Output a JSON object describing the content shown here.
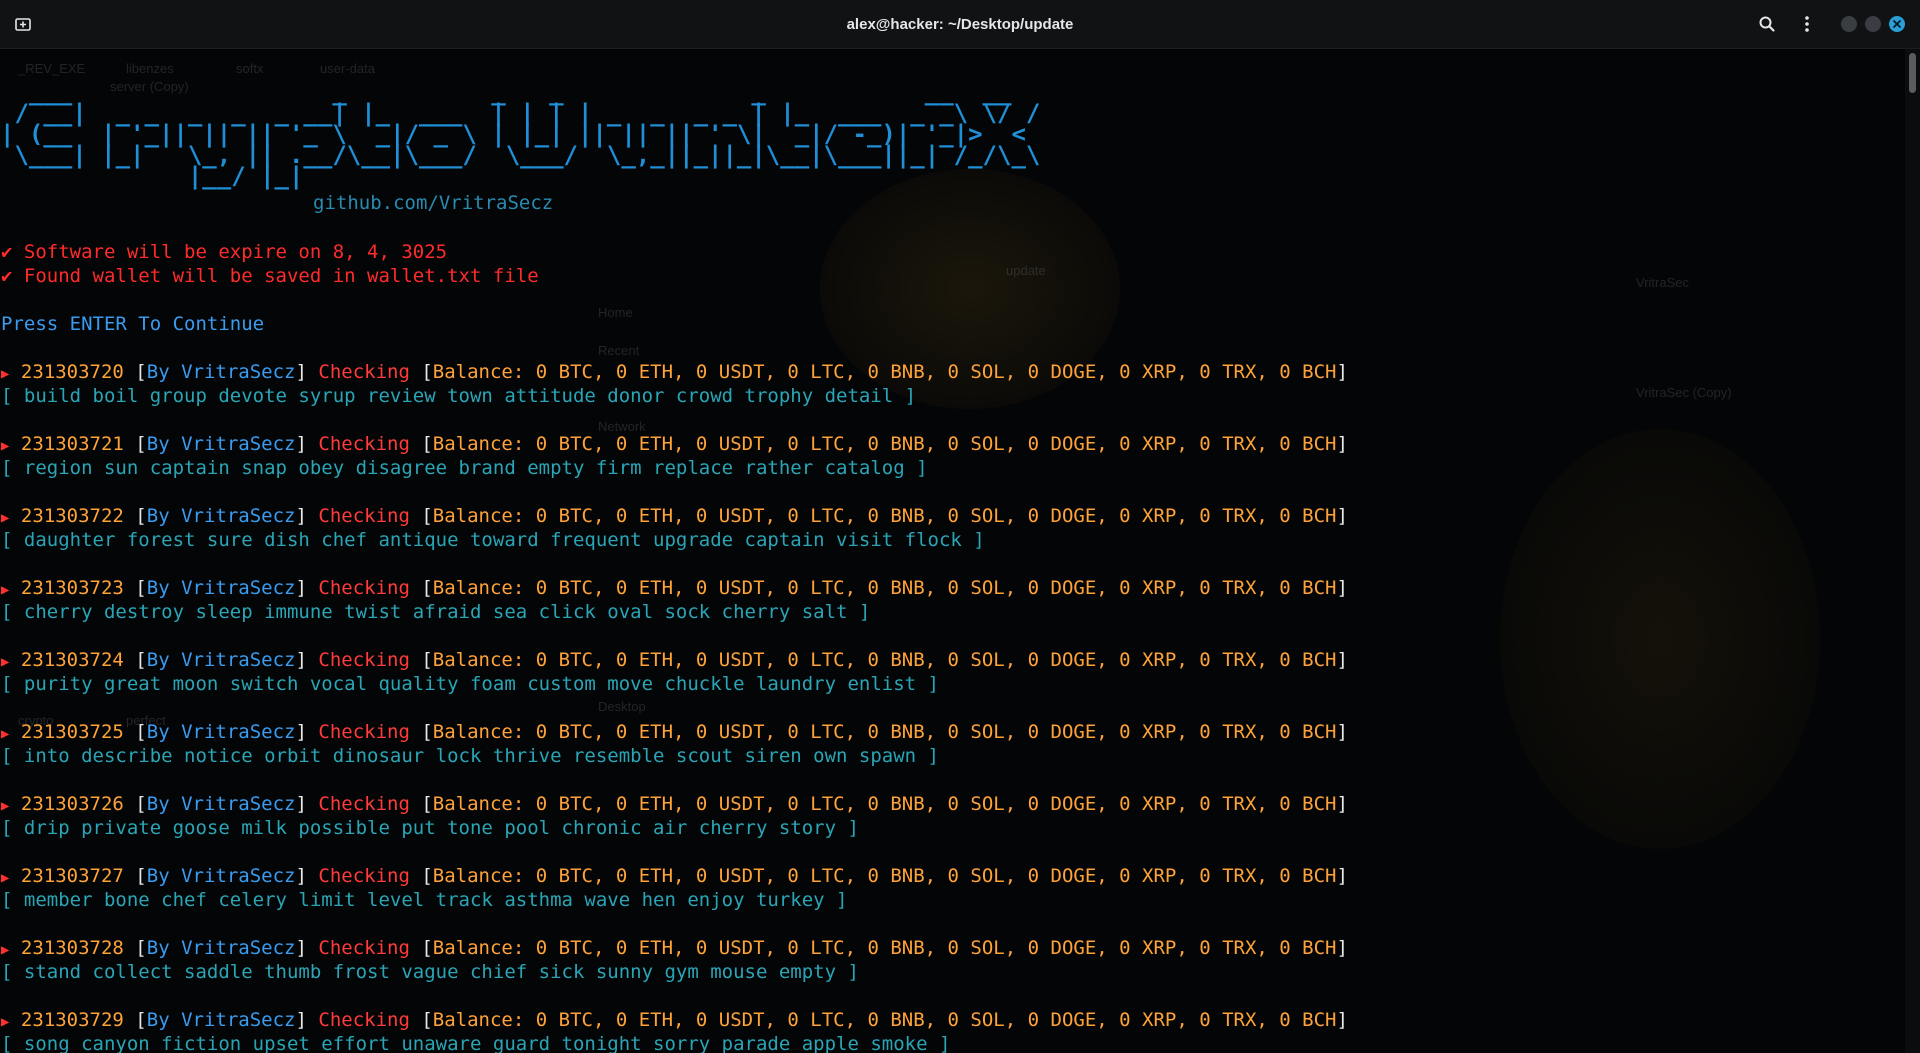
{
  "window": {
    "title": "alex@hacker: ~/Desktop/update"
  },
  "toolbar": {
    "new_tab_icon": "new-tab-icon",
    "search_icon": "search-icon",
    "menu_icon": "kebab-menu-icon",
    "minimize_icon": "minimize-icon",
    "maximize_icon": "maximize-icon",
    "close_icon": "close-icon"
  },
  "terminal": {
    "banner_lines": [
      "  ___                  _          _   _             _           __  __",
      " / __|  _ _  _  _  _ __| |_  ___  | | | | _  _  _ _ | |_  ___  _ _\\ \\/ /",
      "| (__  | '_|| || || '_ \\  _|/ _ \\ | |_| || || || ' \\|  _|/ -_)| '_|>  < ",
      " \\___| |_|   \\_, || .__/\\__|\\___/  \\___/  \\_,_||_||_|\\__|\\___||_| /_/\\_\\",
      "             |__/ |_|"
    ],
    "github": "github.com/VritraSecz",
    "notice1": "✔ Software will be expire on 8, 4, 3025",
    "notice2": "✔ Found wallet will be saved in wallet.txt file",
    "prompt": "Press ENTER To Continue",
    "by_label": "By VritraSecz",
    "checking": "Checking",
    "balance": "Balance: 0 BTC, 0 ETH, 0 USDT, 0 LTC, 0 BNB, 0 SOL, 0 DOGE, 0 XRP, 0 TRX, 0 BCH",
    "entries": [
      {
        "id": "231303720",
        "phrase": "[ build boil group devote syrup review town attitude donor crowd trophy detail ]"
      },
      {
        "id": "231303721",
        "phrase": "[ region sun captain snap obey disagree brand empty firm replace rather catalog ]"
      },
      {
        "id": "231303722",
        "phrase": "[ daughter forest sure dish chef antique toward frequent upgrade captain visit flock ]"
      },
      {
        "id": "231303723",
        "phrase": "[ cherry destroy sleep immune twist afraid sea click oval sock cherry salt ]"
      },
      {
        "id": "231303724",
        "phrase": "[ purity great moon switch vocal quality foam custom move chuckle laundry enlist ]"
      },
      {
        "id": "231303725",
        "phrase": "[ into describe notice orbit dinosaur lock thrive resemble scout siren own spawn ]"
      },
      {
        "id": "231303726",
        "phrase": "[ drip private goose milk possible put tone pool chronic air cherry story ]"
      },
      {
        "id": "231303727",
        "phrase": "[ member bone chef celery limit level track asthma wave hen enjoy turkey ]"
      },
      {
        "id": "231303728",
        "phrase": "[ stand collect saddle thumb frost vague chief sick sunny gym mouse empty ]"
      },
      {
        "id": "231303729",
        "phrase": "[ song canyon fiction upset effort unaware guard tonight sorry parade apple smoke ]"
      }
    ]
  },
  "desktop_ghosts": {
    "items": [
      "_REV_EXE",
      "libenzes",
      "server (Copy)",
      "softx",
      "user-data",
      "VritraSec",
      "VritraSec (Copy)",
      "Home",
      "Recent",
      "Network",
      "Desktop",
      "crypto",
      "perfect",
      "update"
    ]
  },
  "colors": {
    "accent": "#2a9fd6",
    "banner": "#1f8fd8",
    "notice": "#ff2b2b",
    "id": "#ffa238",
    "phrase": "#2aa5b6"
  }
}
